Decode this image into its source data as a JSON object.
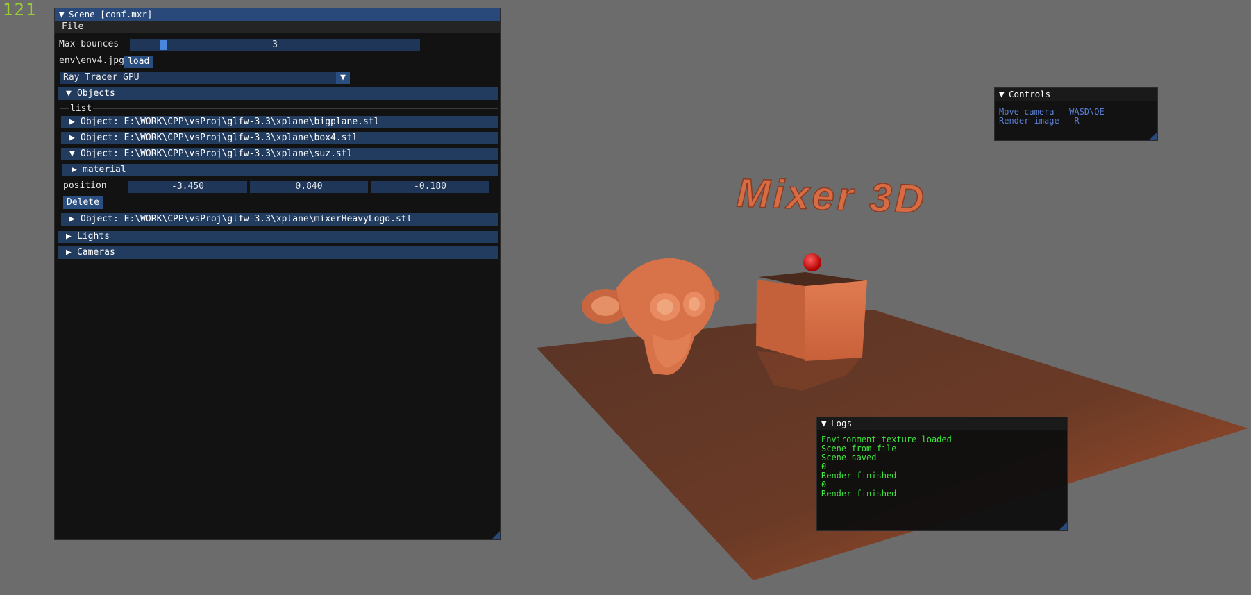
{
  "fps": "121",
  "scene_window": {
    "title": "Scene [conf.mxr]",
    "menu_file": "File",
    "max_bounces_label": "Max bounces",
    "max_bounces_value": "3",
    "max_bounces_fraction": 0.06,
    "env_label": "env\\env4.jpg",
    "load_button": "load",
    "renderer": "Ray Tracer GPU",
    "objects_header": "Objects",
    "list_label": "list",
    "objects": [
      "Object: E:\\WORK\\CPP\\vsProj\\glfw-3.3\\xplane\\bigplane.stl",
      "Object: E:\\WORK\\CPP\\vsProj\\glfw-3.3\\xplane\\box4.stl",
      "Object: E:\\WORK\\CPP\\vsProj\\glfw-3.3\\xplane\\suz.stl",
      "Object: E:\\WORK\\CPP\\vsProj\\glfw-3.3\\xplane\\mixerHeavyLogo.stl"
    ],
    "material_header": "material",
    "position_label": "position",
    "position": [
      "-3.450",
      "0.840",
      "-0.180"
    ],
    "delete_button": "Delete",
    "lights_header": "Lights",
    "cameras_header": "Cameras"
  },
  "controls_window": {
    "title": "Controls",
    "lines": [
      "Move camera - WASD\\QE",
      "Render image - R"
    ]
  },
  "logs_window": {
    "title": "Logs",
    "lines": [
      "Environment texture loaded",
      "Scene from file",
      "Scene saved",
      "0",
      "Render finished",
      "0",
      "Render finished"
    ]
  },
  "viewport": {
    "logo_text": "Mixer 3D"
  },
  "colors": {
    "accent": "#29497a",
    "log_text": "#3ee63e",
    "hint_text": "#5b7fd4",
    "object_color": "#d8734a"
  }
}
